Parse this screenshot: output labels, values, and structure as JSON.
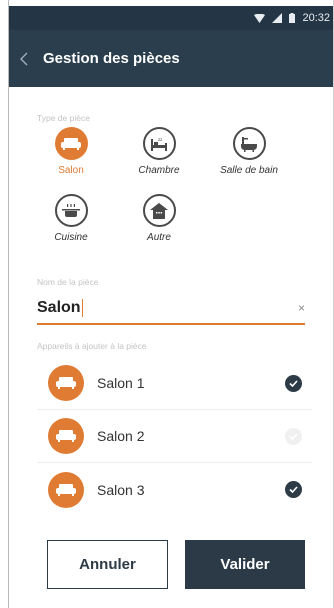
{
  "status": {
    "time": "20:32"
  },
  "header": {
    "title": "Gestion des pièces"
  },
  "room_type": {
    "label": "Type de pièce",
    "items": [
      {
        "label": "Salon",
        "icon": "sofa-icon",
        "selected": true
      },
      {
        "label": "Chambre",
        "icon": "bed-icon",
        "selected": false
      },
      {
        "label": "Salle de bain",
        "icon": "bathtub-icon",
        "selected": false
      },
      {
        "label": "Cuisine",
        "icon": "cooking-pot-icon",
        "selected": false
      },
      {
        "label": "Autre",
        "icon": "house-icon",
        "selected": false
      }
    ]
  },
  "room_name": {
    "label": "Nom de la pièce",
    "value": "Salon",
    "clear": "×"
  },
  "devices": {
    "label": "Appareils à ajouter à la pièce",
    "items": [
      {
        "name": "Salon 1",
        "checked": true
      },
      {
        "name": "Salon 2",
        "checked": false
      },
      {
        "name": "Salon 3",
        "checked": true
      }
    ]
  },
  "actions": {
    "cancel": "Annuler",
    "confirm": "Valider"
  },
  "colors": {
    "accent": "#e07b34",
    "header": "#2a3e4e",
    "statusbar": "#243645",
    "dark": "#2d3b47"
  }
}
